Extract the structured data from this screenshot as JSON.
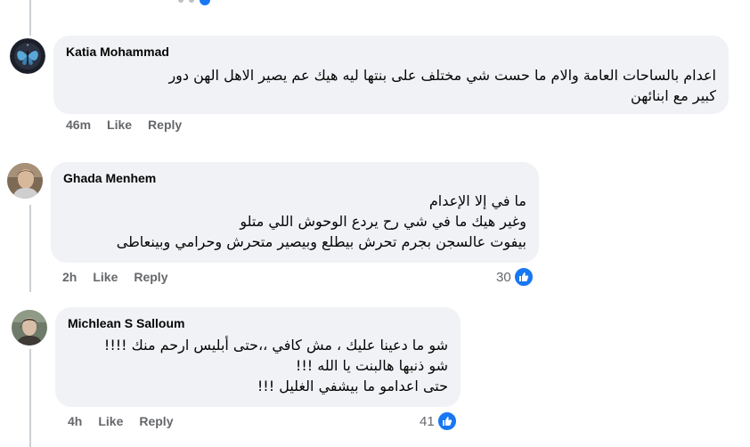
{
  "colors": {
    "bubble_bg": "#f0f2f5",
    "meta_text": "#65676b",
    "like_blue": "#1877f2",
    "thread_line": "#ccd0d5"
  },
  "comments": [
    {
      "author": "Katia Mohammad",
      "avatar_icon": "butterfly-avatar",
      "lines": [
        "اعدام بالساحات العامة والام ما حست شي مختلف على بنتها ليه هيك عم يصير الاهل الهن دور",
        "كبير مع ابنائهن"
      ],
      "time": "46m",
      "like_label": "Like",
      "reply_label": "Reply",
      "reactions": ""
    },
    {
      "author": "Ghada Menhem",
      "avatar_icon": "person-avatar",
      "lines": [
        "ما في إلا الإعدام",
        "وغير هيك ما في شي رح يردع الوحوش اللي متلو",
        "بيفوت عالسجن بجرم تحرش بيطلع وبيصير متحرش وحرامي وبينعاطى"
      ],
      "time": "2h",
      "like_label": "Like",
      "reply_label": "Reply",
      "reactions": "30"
    },
    {
      "author": "Michlean S Salloum",
      "avatar_icon": "person-avatar",
      "lines": [
        "شو ما دعينا عليك ، مش كافي ،،حتى أبليس ارحم منك !!!!",
        "شو ذنبها هالبنت يا الله !!!",
        "حتى اعدامو ما بيشفي الغليل !!!"
      ],
      "time": "4h",
      "like_label": "Like",
      "reply_label": "Reply",
      "reactions": "41"
    }
  ]
}
